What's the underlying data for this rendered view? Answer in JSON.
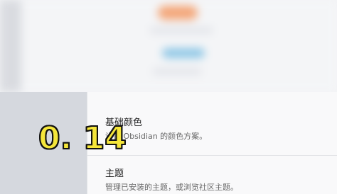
{
  "settings": {
    "items": [
      {
        "title": "基础颜色",
        "description": "设置 Obsidian 的颜色方案。"
      },
      {
        "title": "主题",
        "description": "管理已安装的主题，或浏览社区主题。"
      }
    ]
  },
  "overlay": {
    "label": "0. 14"
  },
  "colors": {
    "accent_orange": "#f4a77a",
    "accent_blue": "#8ec7e6",
    "overlay_text": "#f5e63a"
  }
}
